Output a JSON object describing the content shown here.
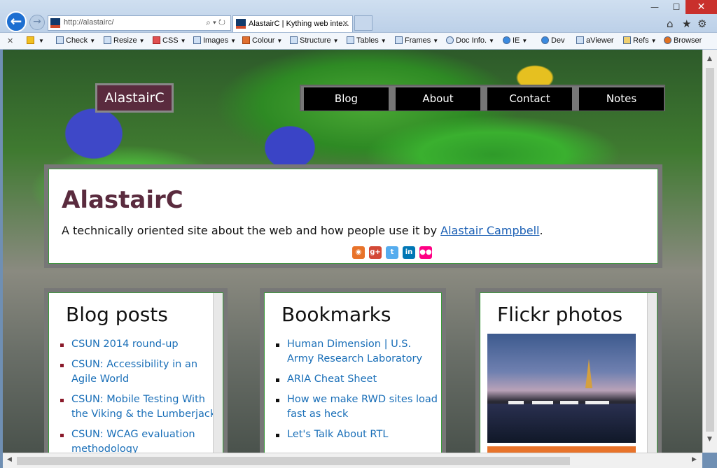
{
  "browser": {
    "address": "http://alastairc/",
    "tab_title": "AlastairC | Kything web inte...",
    "tab_close": "✕",
    "window_controls": {
      "minimize": "—",
      "maximize": "☐",
      "close": "✕"
    },
    "right_icons": {
      "home": "⌂",
      "favorites": "★",
      "settings": "⚙"
    }
  },
  "toolbar": {
    "close": "✕",
    "items": [
      "Check",
      "Resize",
      "CSS",
      "Images",
      "Colour",
      "Structure",
      "Tables",
      "Frames",
      "Doc Info.",
      "IE",
      "Dev",
      "aViewer",
      "Refs",
      "Browser"
    ]
  },
  "site": {
    "brand": "AlastairC",
    "nav": [
      "Blog",
      "About",
      "Contact",
      "Notes"
    ],
    "title": "AlastairC",
    "tagline_pre": "A technically oriented site about the web and how people use it by ",
    "tagline_link": "Alastair Campbell",
    "tagline_post": ".",
    "social_icons": [
      "blogger-icon",
      "google-plus-icon",
      "twitter-icon",
      "linkedin-icon",
      "flickr-icon"
    ],
    "social_colors": [
      "#e8732a",
      "#d34836",
      "#55acee",
      "#0077b5",
      "#ff0084"
    ]
  },
  "blog_posts": {
    "heading": "Blog posts",
    "items": [
      "CSUN 2014 round-up",
      "CSUN: Accessibility in an Agile World",
      "CSUN: Mobile Testing With the Viking & the Lumberjack",
      "CSUN: WCAG evaluation methodology"
    ]
  },
  "bookmarks": {
    "heading": "Bookmarks",
    "items": [
      "Human Dimension | U.S. Army Research Laboratory",
      "ARIA Cheat Sheet",
      "How we make RWD sites load fast as heck",
      "Let's Talk About RTL"
    ]
  },
  "flickr": {
    "heading": "Flickr photos"
  }
}
